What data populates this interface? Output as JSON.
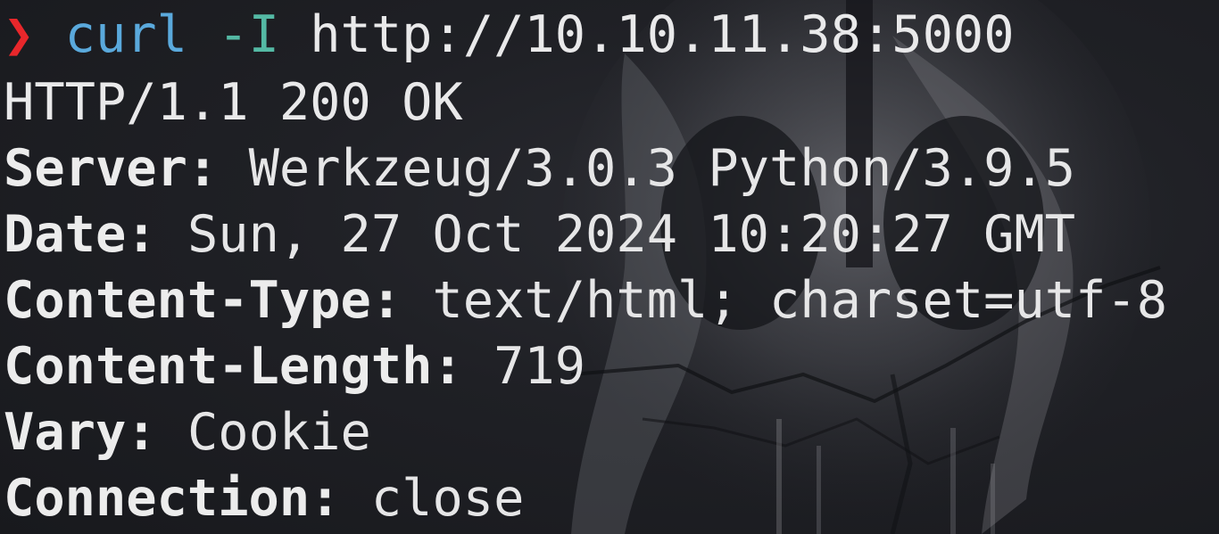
{
  "terminal": {
    "prompt_symbol": "❯",
    "command": {
      "program": "curl",
      "flag": "-I",
      "url": "http://10.10.11.38:5000"
    },
    "status_line": "HTTP/1.1 200 OK",
    "headers": [
      {
        "key": "Server",
        "value": "Werkzeug/3.0.3 Python/3.9.5"
      },
      {
        "key": "Date",
        "value": "Sun, 27 Oct 2024 10:20:27 GMT"
      },
      {
        "key": "Content-Type",
        "value": "text/html; charset=utf-8"
      },
      {
        "key": "Content-Length",
        "value": "719"
      },
      {
        "key": "Vary",
        "value": "Cookie"
      },
      {
        "key": "Connection",
        "value": "close"
      }
    ]
  },
  "colors": {
    "background": "#1c1d22",
    "prompt": "#e8272b",
    "command": "#5aa9dc",
    "flag": "#54b9a4",
    "text": "#e9e9ea"
  }
}
